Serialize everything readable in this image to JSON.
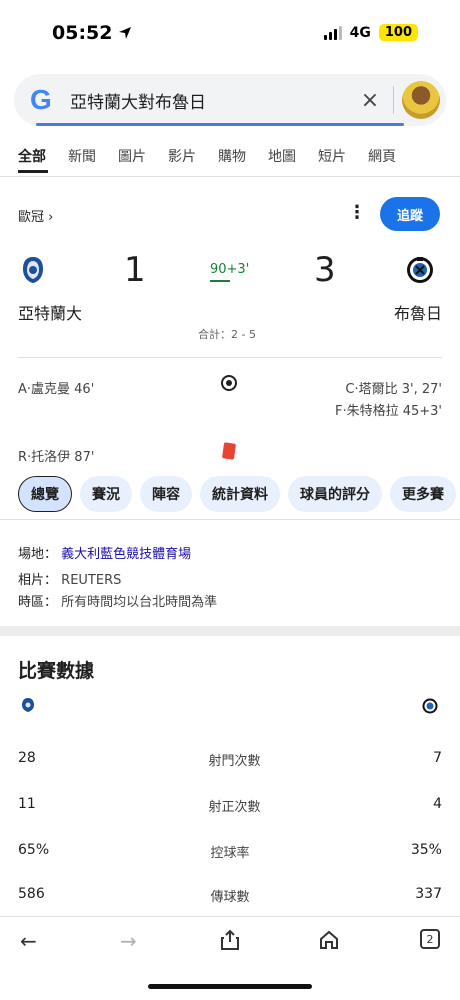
{
  "status_bar": {
    "time": "05:52",
    "network": "4G",
    "battery": "100"
  },
  "search": {
    "query": "亞特蘭大對布魯日"
  },
  "tabs": [
    {
      "label": "全部"
    },
    {
      "label": "新聞"
    },
    {
      "label": "圖片"
    },
    {
      "label": "影片"
    },
    {
      "label": "購物"
    },
    {
      "label": "地圖"
    },
    {
      "label": "短片"
    },
    {
      "label": "網頁"
    }
  ],
  "match": {
    "competition": "歐冠 ›",
    "follow_label": "追蹤",
    "home_team": "亞特蘭大",
    "away_team": "布魯日",
    "home_score": "1",
    "away_score": "3",
    "minute": "90+3'",
    "aggregate": "合計：2 - 5",
    "events": {
      "home_goal": "A·盧克曼 46'",
      "away_goal_1": "C·塔爾比 3', 27'",
      "away_goal_2": "F·朱特格拉 45+3'",
      "home_red": "R·托洛伊 87'"
    }
  },
  "chips": [
    {
      "label": "總覽"
    },
    {
      "label": "賽況"
    },
    {
      "label": "陣容"
    },
    {
      "label": "統計資料"
    },
    {
      "label": "球員的評分"
    },
    {
      "label": "更多賽"
    }
  ],
  "info": {
    "venue_label": "場地：",
    "venue_value": "義大利藍色競技體育場",
    "photo_label": "相片：",
    "photo_value": "REUTERS",
    "tz_label": "時區：",
    "tz_value": "所有時間均以台北時間為準"
  },
  "stats": {
    "title": "比賽數據",
    "rows": [
      {
        "home": "28",
        "label": "射門次數",
        "away": "7"
      },
      {
        "home": "11",
        "label": "射正次數",
        "away": "4"
      },
      {
        "home": "65%",
        "label": "控球率",
        "away": "35%"
      },
      {
        "home": "586",
        "label": "傳球數",
        "away": "337"
      }
    ]
  },
  "toolbar": {
    "tab_count": "2"
  },
  "colors": {
    "accent": "#1a73e8",
    "live_green": "#188038",
    "red_card": "#ea4335",
    "chip_bg": "#e8f0fe"
  }
}
